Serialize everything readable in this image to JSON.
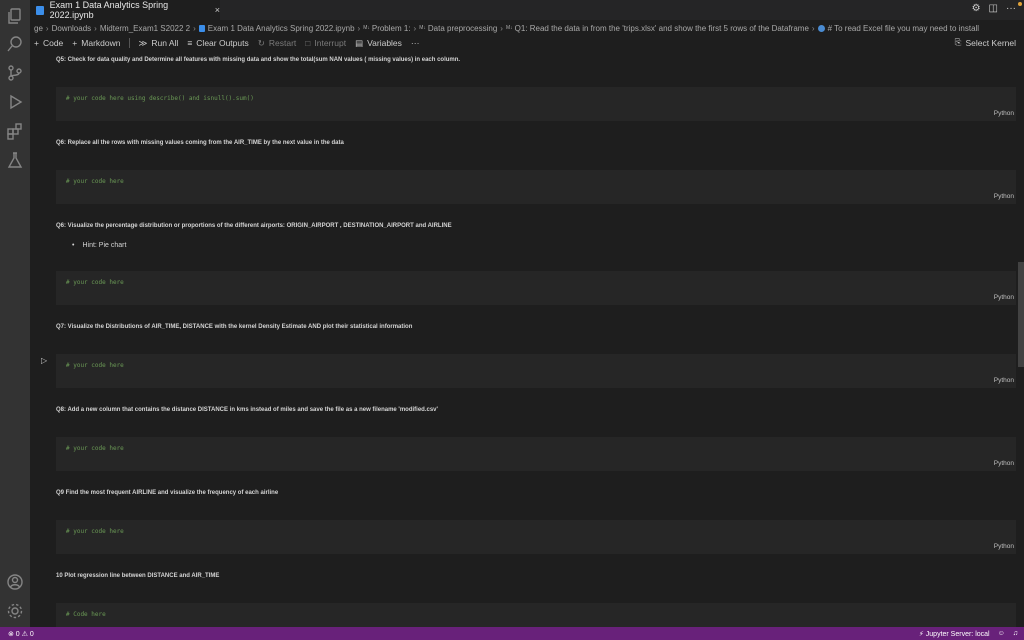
{
  "tab": {
    "title": "Exam 1 Data Analytics Spring 2022.ipynb",
    "close": "×"
  },
  "tab_actions": {
    "settings": "⚙",
    "layout": "◫",
    "more": "···"
  },
  "breadcrumb": {
    "items": [
      "ge",
      "Downloads",
      "Midterm_Exam1 S2022 2",
      "Exam 1 Data Analytics Spring 2022.ipynb",
      "Problem 1:",
      "Data preprocessing",
      "Q1: Read the data in from the 'trips.xlsx' and show the first 5 rows of the Dataframe",
      "# To read Excel file you may need to install"
    ],
    "md_tag": "M↓"
  },
  "toolbar": {
    "code": "Code",
    "markdown": "Markdown",
    "run_all": "Run All",
    "clear_outputs": "Clear Outputs",
    "restart": "Restart",
    "interrupt": "Interrupt",
    "variables": "Variables",
    "more": "···",
    "select_kernel": "Select Kernel"
  },
  "cells": {
    "q5": "Q5: Check for data quality and Determine all features with missing data and show the total(sum NAN values ( missing values) in each column.",
    "q5_code": "# your code here  using describe() and isnull().sum()",
    "q6a": "Q6: Replace all the rows with missing values coming from the AIR_TIME by the next value in the data",
    "q6a_code": "# your code here",
    "q6b": "Q6: Visualize the percentage distribution or proportions of the different airports: ORIGIN_AIRPORT , DESTINATION_AIRPORT and AIRLINE",
    "q6b_hint": "Hint: Pie chart",
    "q6b_code": "# your code here",
    "q7": "Q7: Visualize the Distributions of AIR_TIME, DISTANCE with the kernel Density Estimate AND plot their statistical information",
    "q7_code": "# your code here",
    "q8": "Q8: Add a new column that contains the distance DISTANCE in kms instead of miles and save the file as a new filename 'modified.csv'",
    "q8_code": "# your code here",
    "q9": "Q9 Find the most frequent AIRLINE and visualize the frequency of each airline",
    "q9_code": "# your code here",
    "q10": "10 Plot regression line between DISTANCE and AIR_TIME",
    "q10_code": "# Code here",
    "lang": "Python",
    "run": "▷"
  },
  "status": {
    "problems": "⊗ 0  ⚠ 0",
    "server": "Jupyter Server: local"
  },
  "colors": {
    "status_bar": "#68217a",
    "editor_bg": "#1e1e1e",
    "cell_bg": "#262626",
    "comment": "#6a9955"
  }
}
